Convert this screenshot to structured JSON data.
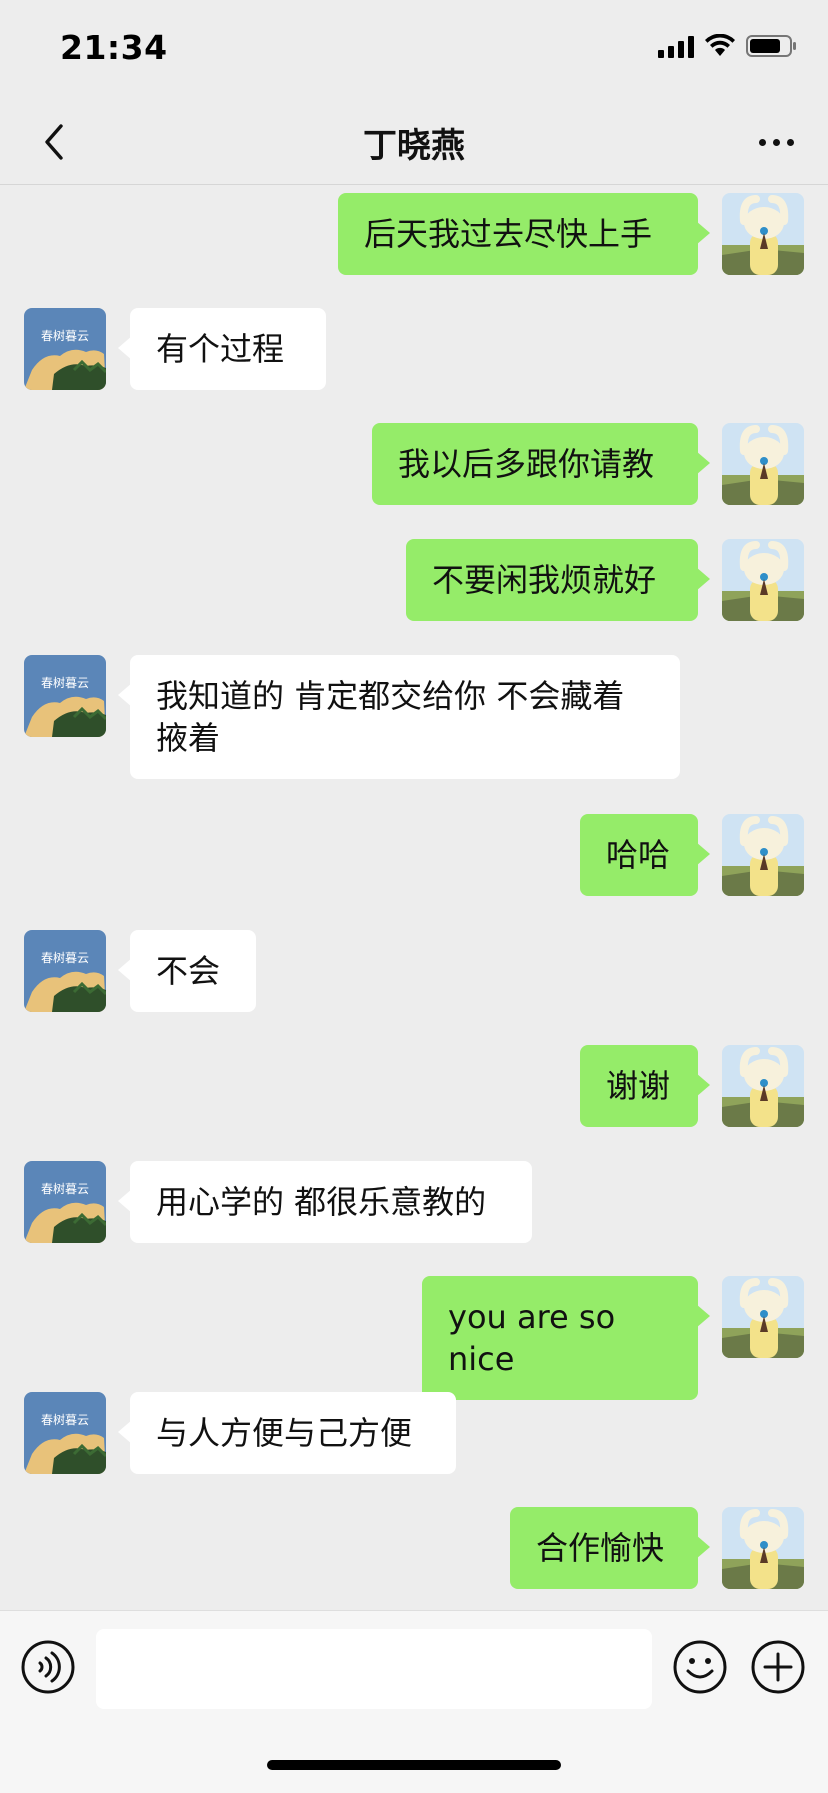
{
  "status_bar": {
    "time": "21:34",
    "icons": [
      "cellular-signal-icon",
      "wifi-icon",
      "battery-icon"
    ]
  },
  "header": {
    "title": "丁晓燕",
    "back_icon": "chevron-left-icon",
    "more_icon": "ellipsis-icon"
  },
  "messages": [
    {
      "side": "right",
      "text": "后天我过去尽快上手"
    },
    {
      "side": "left",
      "text": "有个过程"
    },
    {
      "side": "right",
      "text": "我以后多跟你请教"
    },
    {
      "side": "right",
      "text": "不要闲我烦就好"
    },
    {
      "side": "left",
      "text": "我知道的 肯定都交给你 不会藏着掖着"
    },
    {
      "side": "right",
      "text": "哈哈"
    },
    {
      "side": "left",
      "text": "不会"
    },
    {
      "side": "right",
      "text": "谢谢"
    },
    {
      "side": "left",
      "text": "用心学的 都很乐意教的"
    },
    {
      "side": "right",
      "text": "you are so nice"
    },
    {
      "side": "left",
      "text": "与人方便与己方便"
    },
    {
      "side": "right",
      "text": "合作愉快"
    }
  ],
  "contact_avatar_caption": "春树暮云",
  "input_bar": {
    "value": "",
    "placeholder": "",
    "voice_icon": "voice-icon",
    "emoji_icon": "emoji-icon",
    "plus_icon": "plus-icon"
  },
  "colors": {
    "background": "#ededed",
    "outgoing_bubble": "#95ec69",
    "incoming_bubble": "#ffffff"
  }
}
